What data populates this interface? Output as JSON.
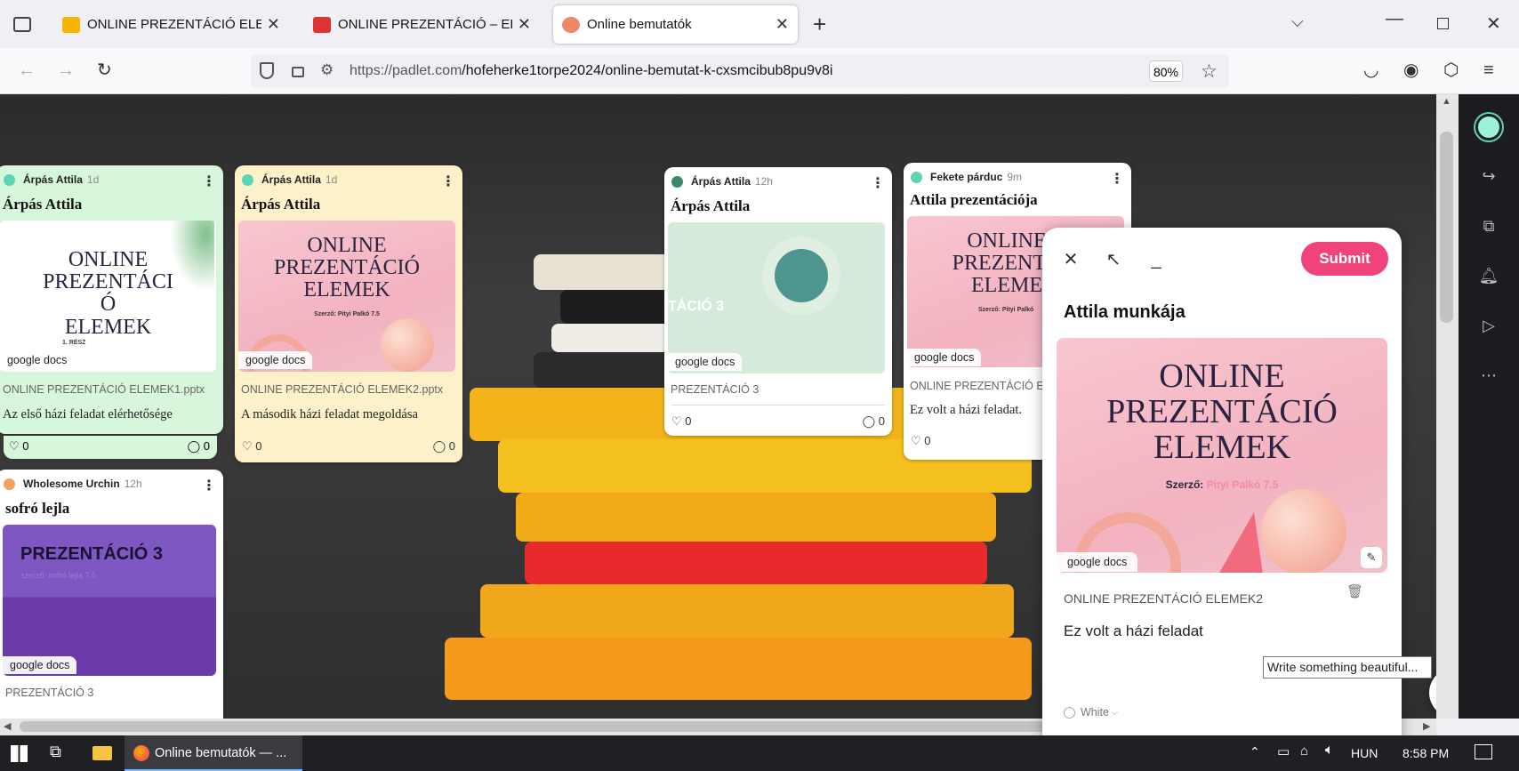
{
  "tabs": [
    {
      "title": "ONLINE PREZENTÁCIÓ ELEMEK",
      "fav": "#f5b400"
    },
    {
      "title": "ONLINE PREZENTÁCIÓ – ELEMEK",
      "fav": "#d33"
    },
    {
      "title": "Online bemutatók",
      "fav": "#e86"
    }
  ],
  "url": {
    "host": "https://padlet.com",
    "path": "/hofeherke1torpe2024/online-bemutat-k-cxsmcibub8pu9v8i",
    "zoom": "80%"
  },
  "cards": [
    {
      "author": "Árpás Attila",
      "age": "1d",
      "title": "Árpás Attila",
      "thumb_lines": [
        "ONLINE",
        "PREZENTÁCI",
        "Ó",
        "ELEMEK"
      ],
      "thumb_small": "1. RÉSZ",
      "tag": "google docs",
      "fname": "ONLINE PREZENTÁCIÓ ELEMEK1.pptx",
      "desc": "Az első házi feladat elérhetősége",
      "likes": "0",
      "comments": "0"
    },
    {
      "author": "Árpás Attila",
      "age": "1d",
      "title": "Árpás Attila",
      "thumb_lines": [
        "ONLINE",
        "PREZENTÁCIÓ",
        "ELEMEK"
      ],
      "thumb_small": "Szerző: Pityi Palkó 7.5",
      "tag": "google docs",
      "fname": "ONLINE PREZENTÁCIÓ ELEMEK2.pptx",
      "desc": "A második házi feladat megoldása",
      "likes": "0",
      "comments": "0"
    },
    {
      "author": "Árpás Attila",
      "age": "12h",
      "title": "Árpás Attila",
      "thumb_lines": [
        "TÁCIÓ 3"
      ],
      "thumb_small": "",
      "tag": "google docs",
      "fname": "PREZENTÁCIÓ 3",
      "desc": "",
      "likes": "0",
      "comments": "0"
    },
    {
      "author": "Fekete párduc",
      "age": "9m",
      "title": "Attila prezentációja",
      "thumb_lines": [
        "ONLINE",
        "PREZENTÁ",
        "ELEME"
      ],
      "thumb_small": "Szerző: Pityi Palkó",
      "tag": "google docs",
      "fname": "ONLINE PREZENTÁCIÓ E",
      "desc": "Ez volt a házi feladat.",
      "likes": "0",
      "comments": ""
    },
    {
      "author": "Wholesome Urchin",
      "age": "12h",
      "title": "sofró lejla",
      "thumb_lines": [
        "PREZENTÁCIÓ 3"
      ],
      "thumb_small": "szerző: sofró lejla 7.5",
      "tag": "google docs",
      "fname": "PREZENTÁCIÓ 3",
      "desc": "",
      "likes": "0",
      "comments": "0"
    }
  ],
  "panel": {
    "submit": "Submit",
    "title": "Attila munkája",
    "thumb_lines": [
      "ONLINE",
      "PREZENTÁCIÓ",
      "ELEMEK"
    ],
    "thumb_author_label": "Szerző:",
    "thumb_author_name": "Pityi Palkó",
    "thumb_author_grade": "7.5",
    "tag": "google docs",
    "fname": "ONLINE PREZENTÁCIÓ ELEMEK2",
    "body": "Ez volt a házi feladat",
    "tooltip": "Write something beautiful...",
    "color": "White"
  },
  "taskbar": {
    "app": "Online bemutatók — ...",
    "lang": "HUN",
    "time": "8:58 PM"
  }
}
